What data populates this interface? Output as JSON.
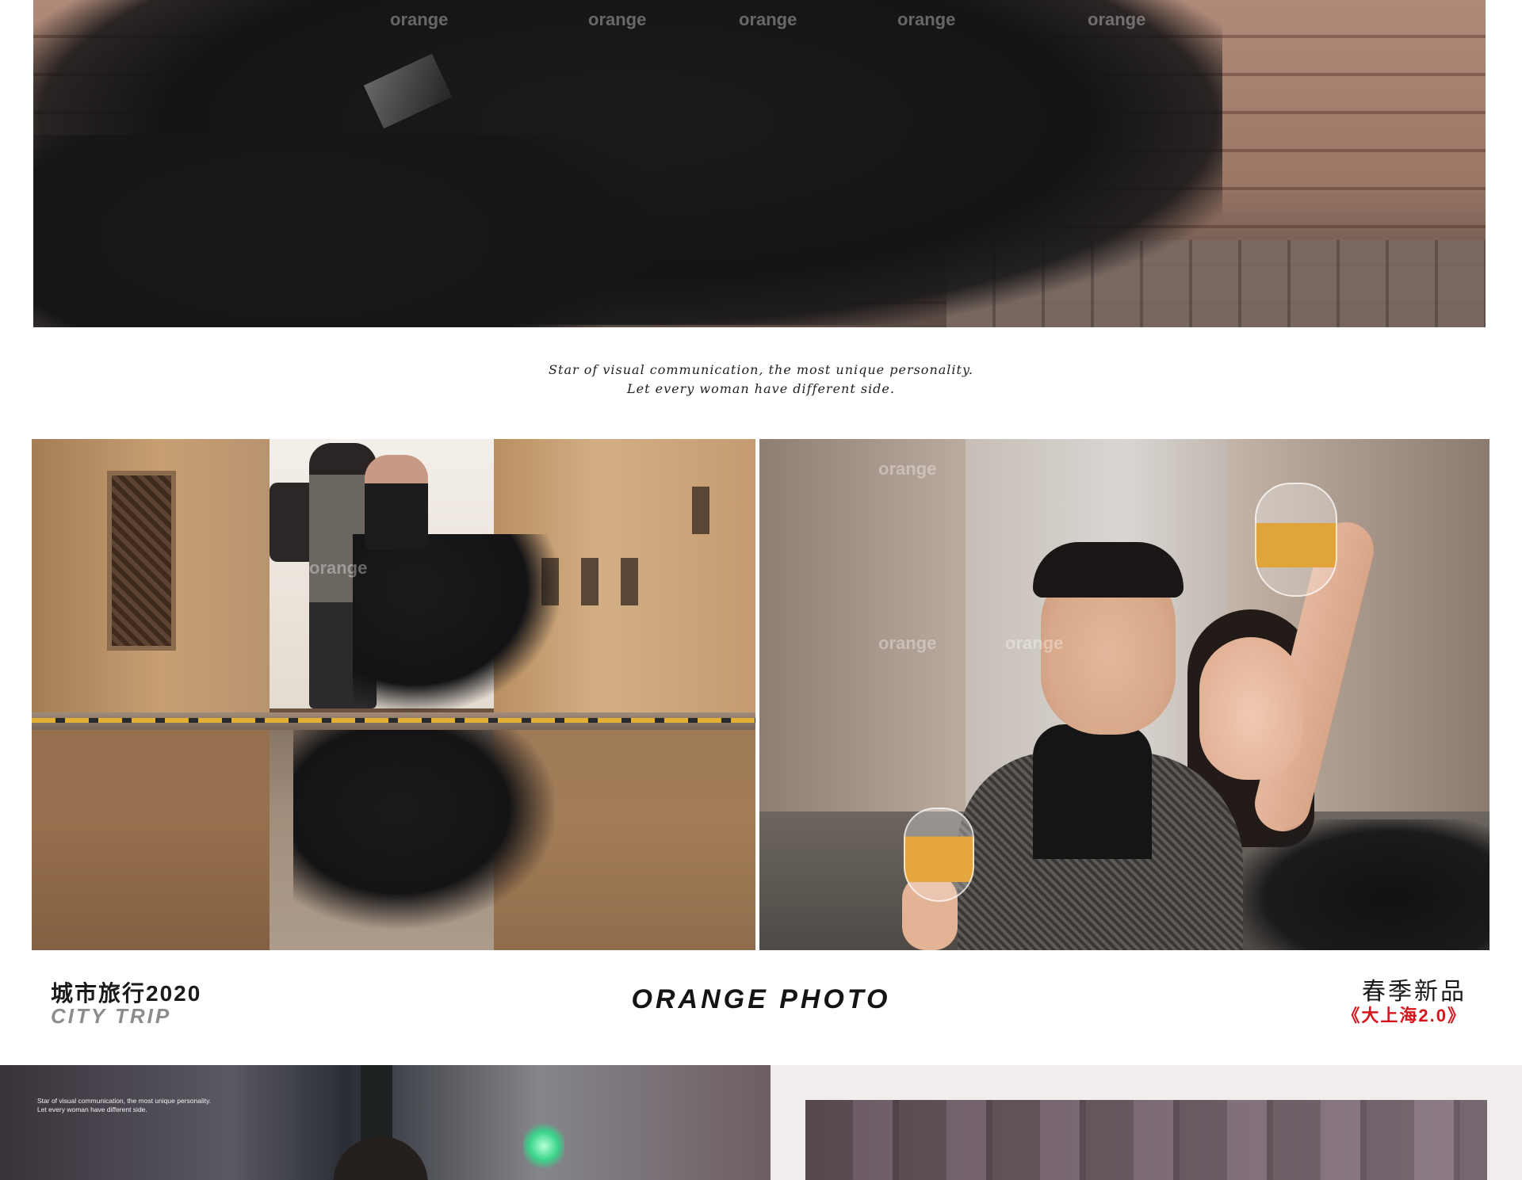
{
  "tagline": {
    "line1": "Star of visual communication, the most unique personality.",
    "line2": "Let every woman have different side."
  },
  "watermark": "orange",
  "caption": {
    "left_cn": "城市旅行2020",
    "left_en": "CITY TRIP",
    "center": "ORANGE PHOTO",
    "right_cn": "春季新品",
    "right_edition": "《大上海2.0》"
  },
  "bottom_left_tagline": {
    "line1": "Star of visual communication, the most unique personality.",
    "line2": "Let every woman have different side."
  },
  "colors": {
    "edition_red": "#d8141b",
    "text_dark": "#1a1a1a",
    "text_grey": "#8c8c8c"
  }
}
